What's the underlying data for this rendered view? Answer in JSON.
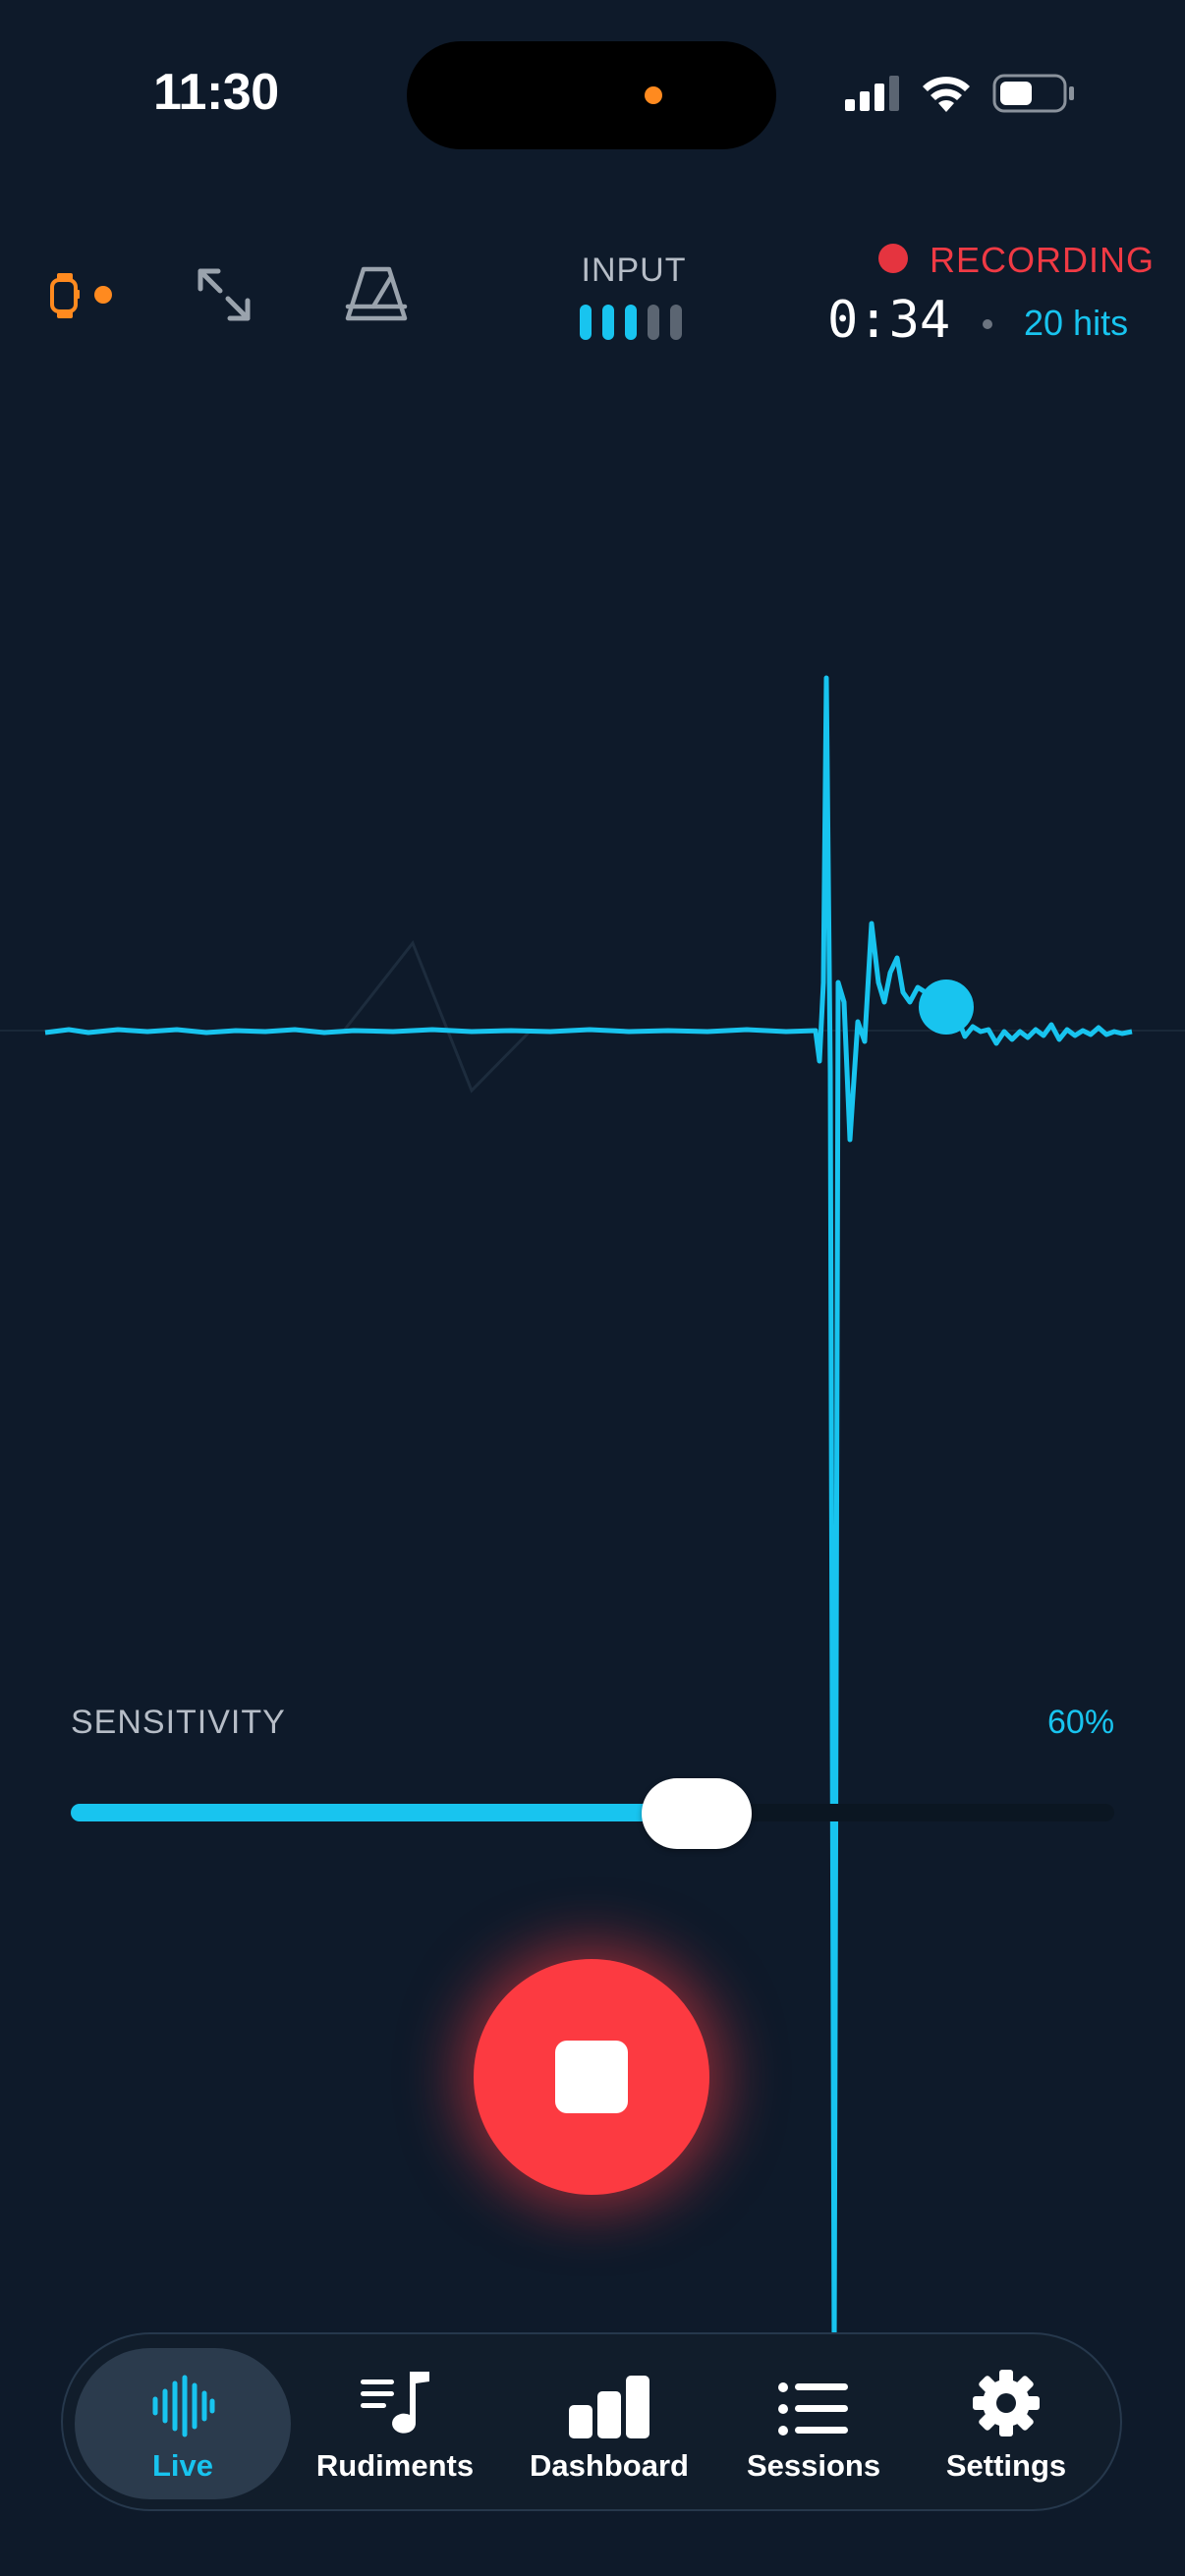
{
  "status_bar": {
    "time": "11:30"
  },
  "header": {
    "input_label": "INPUT",
    "input_level": 0.6,
    "recording_label": "RECORDING",
    "timer": "0:34",
    "hits": "20 hits"
  },
  "sensitivity": {
    "label": "SENSITIVITY",
    "value_text": "60%",
    "value": 0.6
  },
  "tabs": [
    {
      "label": "Live",
      "icon": "waveform-icon",
      "active": true
    },
    {
      "label": "Rudiments",
      "icon": "music-note-list-icon",
      "active": false
    },
    {
      "label": "Dashboard",
      "icon": "bar-chart-icon",
      "active": false
    },
    {
      "label": "Sessions",
      "icon": "list-icon",
      "active": false
    },
    {
      "label": "Settings",
      "icon": "gear-icon",
      "active": false
    }
  ],
  "colors": {
    "background": "#0e1a2a",
    "accent": "#18c4ef",
    "recording": "#f03a44",
    "stop_button": "#fc3a41",
    "watch": "#ff8a1f"
  }
}
